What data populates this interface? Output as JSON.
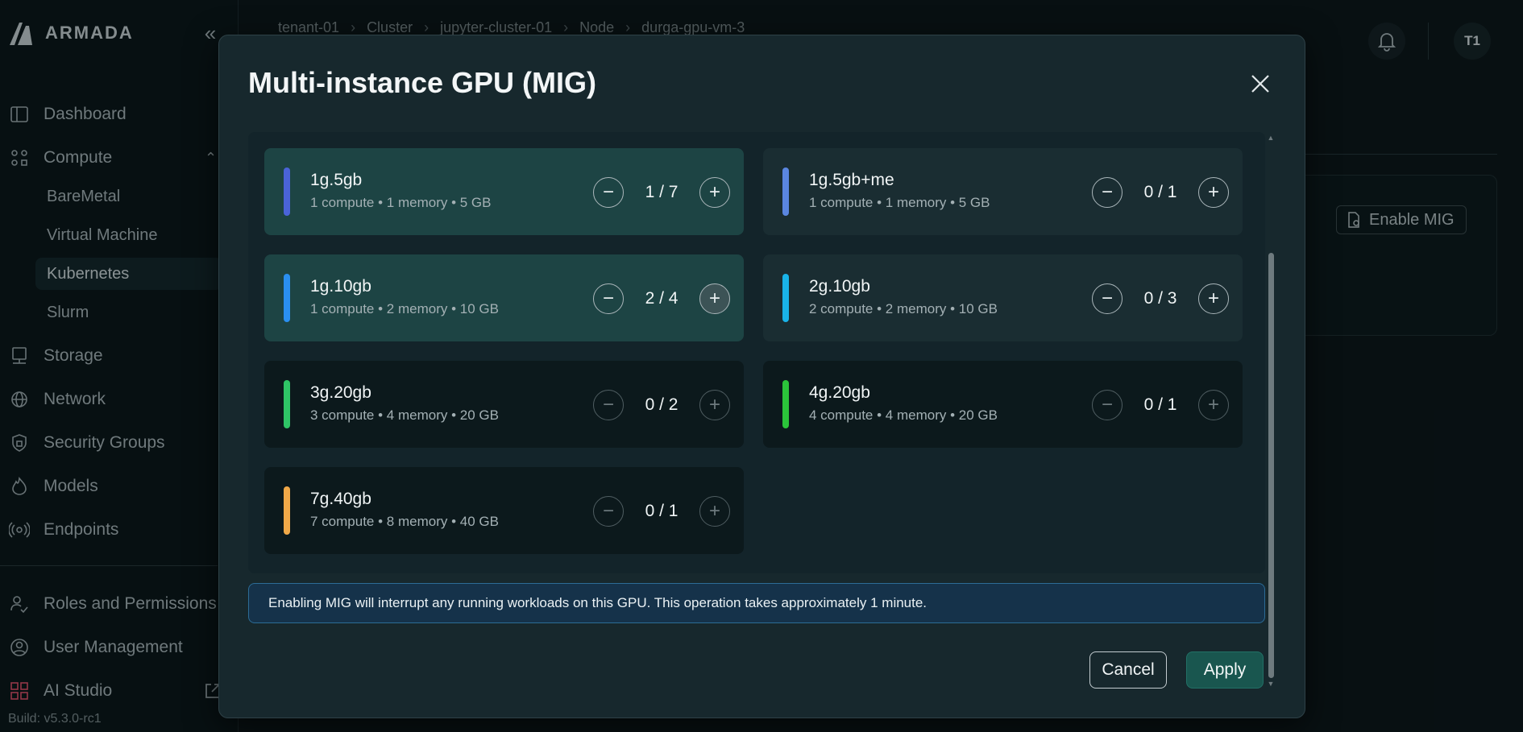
{
  "app": {
    "logo_text": "ARMADA",
    "build": "Build: v5.3.0-rc1"
  },
  "sidebar": {
    "items": [
      {
        "label": "Dashboard",
        "icon": "dashboard-icon"
      },
      {
        "label": "Compute",
        "icon": "compute-icon"
      },
      {
        "label": "Storage",
        "icon": "storage-icon"
      },
      {
        "label": "Network",
        "icon": "globe-icon"
      },
      {
        "label": "Security Groups",
        "icon": "shield-icon"
      },
      {
        "label": "Models",
        "icon": "flame-icon"
      },
      {
        "label": "Endpoints",
        "icon": "broadcast-icon"
      },
      {
        "label": "Roles and Permissions",
        "icon": "users-check-icon"
      },
      {
        "label": "User Management",
        "icon": "user-circle-icon"
      },
      {
        "label": "AI Studio",
        "icon": "grid-icon"
      }
    ],
    "compute_sub": [
      {
        "label": "BareMetal"
      },
      {
        "label": "Virtual Machine"
      },
      {
        "label": "Kubernetes"
      },
      {
        "label": "Slurm"
      }
    ]
  },
  "breadcrumb": [
    "tenant-01",
    "Cluster",
    "jupyter-cluster-01",
    "Node",
    "durga-gpu-vm-3"
  ],
  "header": {
    "avatar": "T1"
  },
  "background": {
    "enable_mig": "Enable MIG"
  },
  "modal": {
    "title": "Multi-instance GPU (MIG)",
    "profiles": [
      {
        "name": "1g.5gb",
        "desc": "1 compute • 1 memory • 5 GB",
        "count": "1 / 7",
        "color": "#4a63d8"
      },
      {
        "name": "1g.5gb+me",
        "desc": "1 compute • 1 memory • 5 GB",
        "count": "0 / 1",
        "color": "#5a86e0"
      },
      {
        "name": "1g.10gb",
        "desc": "1 compute • 2 memory • 10 GB",
        "count": "2 / 4",
        "color": "#2a8ff0"
      },
      {
        "name": "2g.10gb",
        "desc": "2 compute • 2 memory • 10 GB",
        "count": "0 / 3",
        "color": "#19b3e8"
      },
      {
        "name": "3g.20gb",
        "desc": "3 compute • 4 memory • 20 GB",
        "count": "0 / 2",
        "color": "#2fc466"
      },
      {
        "name": "4g.20gb",
        "desc": "4 compute • 4 memory • 20 GB",
        "count": "0 / 1",
        "color": "#2bc43a"
      },
      {
        "name": "7g.40gb",
        "desc": "7 compute • 8 memory • 40 GB",
        "count": "0 / 1",
        "color": "#f0a848"
      }
    ],
    "warning": "Enabling MIG will interrupt any running workloads on this GPU. This operation takes approximately 1 minute.",
    "cancel_label": "Cancel",
    "apply_label": "Apply"
  }
}
